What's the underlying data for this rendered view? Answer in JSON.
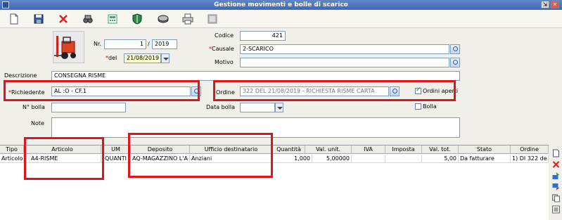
{
  "window": {
    "title": "Gestione movimenti e bolle di scarico"
  },
  "toolbar": {
    "icons": [
      "new-document-icon",
      "save-icon",
      "delete-icon",
      "binoculars-icon",
      "calculator-icon",
      "shield-icon",
      "drive-icon",
      "print-icon",
      "sheets-icon"
    ]
  },
  "form": {
    "nr_label": "Nr.",
    "nr_value": "1",
    "year_sep": "/",
    "year_value": "2019",
    "del_label": "del",
    "del_value": "21/08/2019",
    "codice_label": "Codice",
    "codice_value": "421",
    "causale_label": "Causale",
    "causale_value": "2-SCARICO",
    "motivo_label": "Motivo",
    "motivo_value": "",
    "descrizione_label": "Descrizione",
    "descrizione_value": "CONSEGNA RISME",
    "richiedente_label": "Richiedente",
    "richiedente_value": "AL                              :O - CF.1                                          ",
    "ordine_label": "Ordine",
    "ordine_value": "322 DEL 21/08/2019 - RICHIESTA RISME CARTA",
    "ordini_aperti_label": "Ordini aperti",
    "nbolla_label": "N° bolla",
    "nbolla_value": "",
    "databolla_label": "Data bolla",
    "databolla_value": "",
    "bolla_label": "Bolla",
    "note_label": "Note",
    "note_value": ""
  },
  "grid": {
    "headers": [
      "Tipo",
      "Articolo",
      "UM",
      "Deposito",
      "Ufficio destinatario",
      "Quantità",
      "Val. unit.",
      "IVA",
      "Imposta",
      "Val. tot.",
      "Stato",
      "Ordine"
    ],
    "rows": [
      [
        "Articolo",
        "A4-RISME",
        "-QUANTI",
        "AQ-MAGAZZINO L'A",
        "Anziani",
        "1,000",
        "5,00000",
        "",
        "",
        "5,00",
        "Da fatturare",
        "1) DI 322 de"
      ]
    ]
  },
  "side_icons": [
    "new-row-icon",
    "delete-row-icon",
    "move-up-icon",
    "move-down-icon",
    "copy-row-icon",
    "list-icon"
  ],
  "colors": {
    "highlight": "#e0151b",
    "titlebar": "#4a73bd"
  }
}
